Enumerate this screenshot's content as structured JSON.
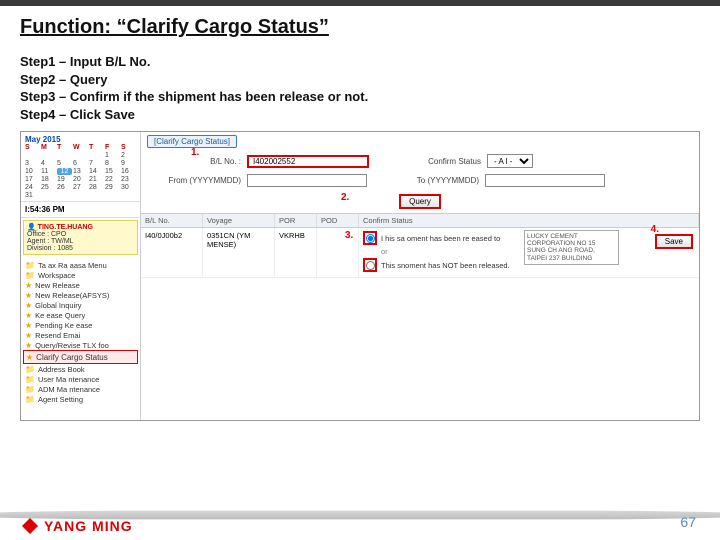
{
  "title": "Function: “Clarify Cargo Status”",
  "steps": [
    "Step1 – Input B/L No.",
    "Step2 – Query",
    "Step3 – Confirm if the shipment has been release or not.",
    "Step4 – Click Save"
  ],
  "app": {
    "calendar": {
      "title": "May 2015",
      "dow": [
        "S",
        "M",
        "T",
        "W",
        "T",
        "F",
        "S"
      ]
    },
    "time": "I:54:36 PM",
    "user": {
      "name": "TING.TE.HUANG",
      "office": "Office : CPO",
      "agent": "Agent : TW/ML",
      "division": "Division : 1085"
    },
    "tree": {
      "root1": "Ta ax Ra aasa Menu",
      "root2": "Workspace",
      "items": [
        "New Release",
        "New Release(AFSYS)",
        "Global Inquiry",
        "Ke ease Query",
        "Pending Ke ease",
        "Resend Emai",
        "Query/Revise TLX foo",
        "Clarify Cargo Status",
        "Address Book",
        "User Ma ntenance",
        "ADM Ma ntenance",
        "Agent Setting"
      ]
    },
    "tab": "[Clarify Cargo Status]",
    "markers": {
      "m1": "1.",
      "m2": "2.",
      "m3": "3.",
      "m4": "4."
    },
    "form": {
      "bl_label": "B/L No. :",
      "bl_value": "I402002552",
      "confirm_label": "Confirm Status",
      "confirm_value": "- A l -",
      "from_label": "From (YYYYMMDD)",
      "to_label": "To (YYYYMMDD)",
      "query_btn": "Query"
    },
    "grid": {
      "headers": [
        "B/L No.",
        "Voyage",
        "POR",
        "POD",
        "Confirm Status"
      ],
      "row": {
        "bl": "I40/0J00b2",
        "voyage": "0351CN (YM\nMENSE)",
        "por": "VKRHB",
        "pod": " "
      }
    },
    "confirm": {
      "line1": "I his sa oment has been re eased to",
      "or": "or",
      "line2": "This snoment has NOT been released.",
      "addr": "LUCKY CEMENT CORPORATION NO 15 SUNG CH ANG ROAD, TAIPEI 237 BUILDING",
      "save": "Save"
    }
  },
  "brand": "YANG MING",
  "page": "67"
}
